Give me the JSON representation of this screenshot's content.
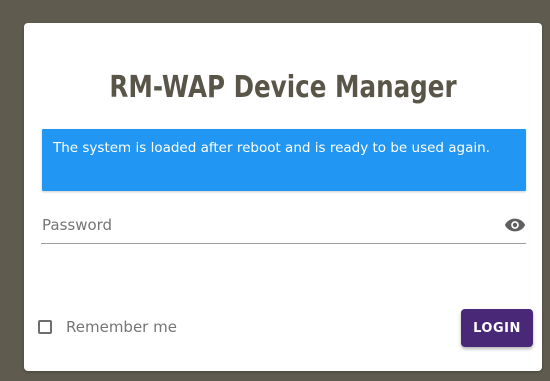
{
  "app": {
    "title": "RM-WAP Device Manager"
  },
  "alert": {
    "message": "The system is loaded after reboot and is ready to be used again.",
    "color": "#2196f3"
  },
  "password": {
    "placeholder": "Password",
    "value": "",
    "visibility_icon": "eye-icon"
  },
  "remember": {
    "label": "Remember me",
    "checked": false
  },
  "login": {
    "label": "LOGIN",
    "color": "#4a2878"
  },
  "colors": {
    "background": "#5f5c4f",
    "card": "#ffffff",
    "title": "#595548"
  }
}
